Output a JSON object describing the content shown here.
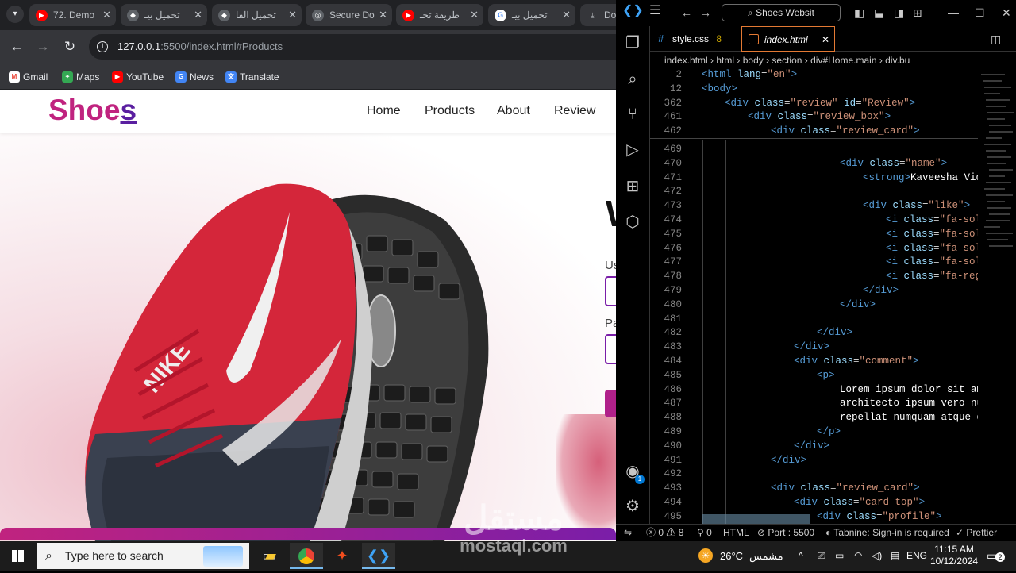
{
  "browser": {
    "tabs": [
      {
        "title": "72. Demo",
        "icon": "youtube-icon"
      },
      {
        "title": "تحميل بيـ",
        "icon": "site-icon"
      },
      {
        "title": "تحميل القا",
        "icon": "site-icon"
      },
      {
        "title": "Secure Do",
        "icon": "globe-icon"
      },
      {
        "title": "طريقة تحـ",
        "icon": "youtube-icon"
      },
      {
        "title": "تحميل بيـ",
        "icon": "google-icon"
      },
      {
        "title": "Dov",
        "icon": "download-icon"
      }
    ],
    "address": {
      "host": "127.0.0.1",
      "path": ":5500/index.html#Products"
    },
    "bookmarks": [
      {
        "label": "Gmail",
        "icon": "gmail-icon"
      },
      {
        "label": "Maps",
        "icon": "maps-icon"
      },
      {
        "label": "YouTube",
        "icon": "youtube-icon"
      },
      {
        "label": "News",
        "icon": "news-icon"
      },
      {
        "label": "Translate",
        "icon": "translate-icon"
      }
    ]
  },
  "site": {
    "logo_main": "Shoe",
    "logo_end": "s",
    "nav": [
      "Home",
      "Products",
      "About",
      "Review"
    ],
    "form_heading_peek": "W",
    "user_label_peek": "Us",
    "pass_label_peek": "Pa",
    "colors": {
      "brand": "#c0237f",
      "accent": "#7a1ea8"
    }
  },
  "vscode": {
    "command_center": "Shoes Websit",
    "tabs": [
      {
        "label": "style.css",
        "badge": "8"
      },
      {
        "label": "index.html",
        "active": true
      }
    ],
    "breadcrumb": [
      "index.html",
      "html",
      "body",
      "section",
      "div#Home.main",
      "div.bu"
    ],
    "sticky_lines": [
      {
        "n": "2",
        "code": "<html lang=\"en\">"
      },
      {
        "n": "12",
        "code": "<body>"
      },
      {
        "n": "362",
        "code": "<div class=\"review\" id=\"Review\">"
      },
      {
        "n": "461",
        "code": "<div class=\"review_box\">"
      },
      {
        "n": "462",
        "code": "<div class=\"review_card\">"
      }
    ],
    "code_lines": [
      {
        "n": "469",
        "code": ""
      },
      {
        "n": "470",
        "code": "<div class=\"name\">"
      },
      {
        "n": "471",
        "code": "<strong>Kaveesha Vid"
      },
      {
        "n": "472",
        "code": ""
      },
      {
        "n": "473",
        "code": "<div class=\"like\">"
      },
      {
        "n": "474",
        "code": "<i class=\"fa-sol"
      },
      {
        "n": "475",
        "code": "<i class=\"fa-sol"
      },
      {
        "n": "476",
        "code": "<i class=\"fa-sol"
      },
      {
        "n": "477",
        "code": "<i class=\"fa-sol"
      },
      {
        "n": "478",
        "code": "<i class=\"fa-reg"
      },
      {
        "n": "479",
        "code": "</div>"
      },
      {
        "n": "480",
        "code": "</div>"
      },
      {
        "n": "481",
        "code": ""
      },
      {
        "n": "482",
        "code": "</div>"
      },
      {
        "n": "483",
        "code": "</div>"
      },
      {
        "n": "484",
        "code": "<div class=\"comment\">"
      },
      {
        "n": "485",
        "code": "<p>"
      },
      {
        "n": "486",
        "code": "Lorem ipsum dolor sit ame"
      },
      {
        "n": "487",
        "code": "architecto ipsum vero nu"
      },
      {
        "n": "488",
        "code": "repellat numquam atque de"
      },
      {
        "n": "489",
        "code": "</p>"
      },
      {
        "n": "490",
        "code": "</div>"
      },
      {
        "n": "491",
        "code": "</div>"
      },
      {
        "n": "492",
        "code": ""
      },
      {
        "n": "493",
        "code": "<div class=\"review_card\">"
      },
      {
        "n": "494",
        "code": "<div class=\"card_top\">"
      },
      {
        "n": "495",
        "code": "<div class=\"profile\">"
      }
    ],
    "status": {
      "errors": "0",
      "warnings": "8",
      "ports": "0",
      "language": "HTML",
      "port": "Port : 5500",
      "tabnine": "Tabnine: Sign-in is required",
      "prettier": "Prettier",
      "accounts_badge": "1"
    }
  },
  "taskbar": {
    "search_placeholder": "Type here to search",
    "weather_temp": "26°C",
    "weather_text": "مشمس",
    "lang": "ENG",
    "time": "11:15 AM",
    "date": "10/12/2024",
    "notifications": "2"
  },
  "watermark": {
    "arabic": "مستقل",
    "latin": "mostaql.com"
  }
}
